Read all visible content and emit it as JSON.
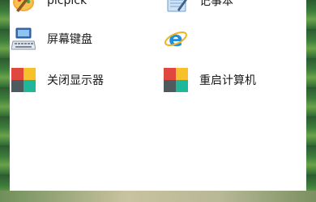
{
  "items": [
    {
      "label": "picpick",
      "icon": "picpick-icon"
    },
    {
      "label": "记事本",
      "icon": "notepad-icon"
    },
    {
      "label": "屏幕键盘",
      "icon": "keyboard-icon"
    },
    {
      "label": "",
      "icon": "internet-explorer-icon"
    },
    {
      "label": "关闭显示器",
      "icon": "tile-icon"
    },
    {
      "label": "重启计算机",
      "icon": "tile-icon"
    }
  ],
  "colors": {
    "tile_red": "#e0483f",
    "tile_yellow": "#f6c12b",
    "tile_dark": "#4f5a5e",
    "tile_teal": "#1fb79a"
  }
}
